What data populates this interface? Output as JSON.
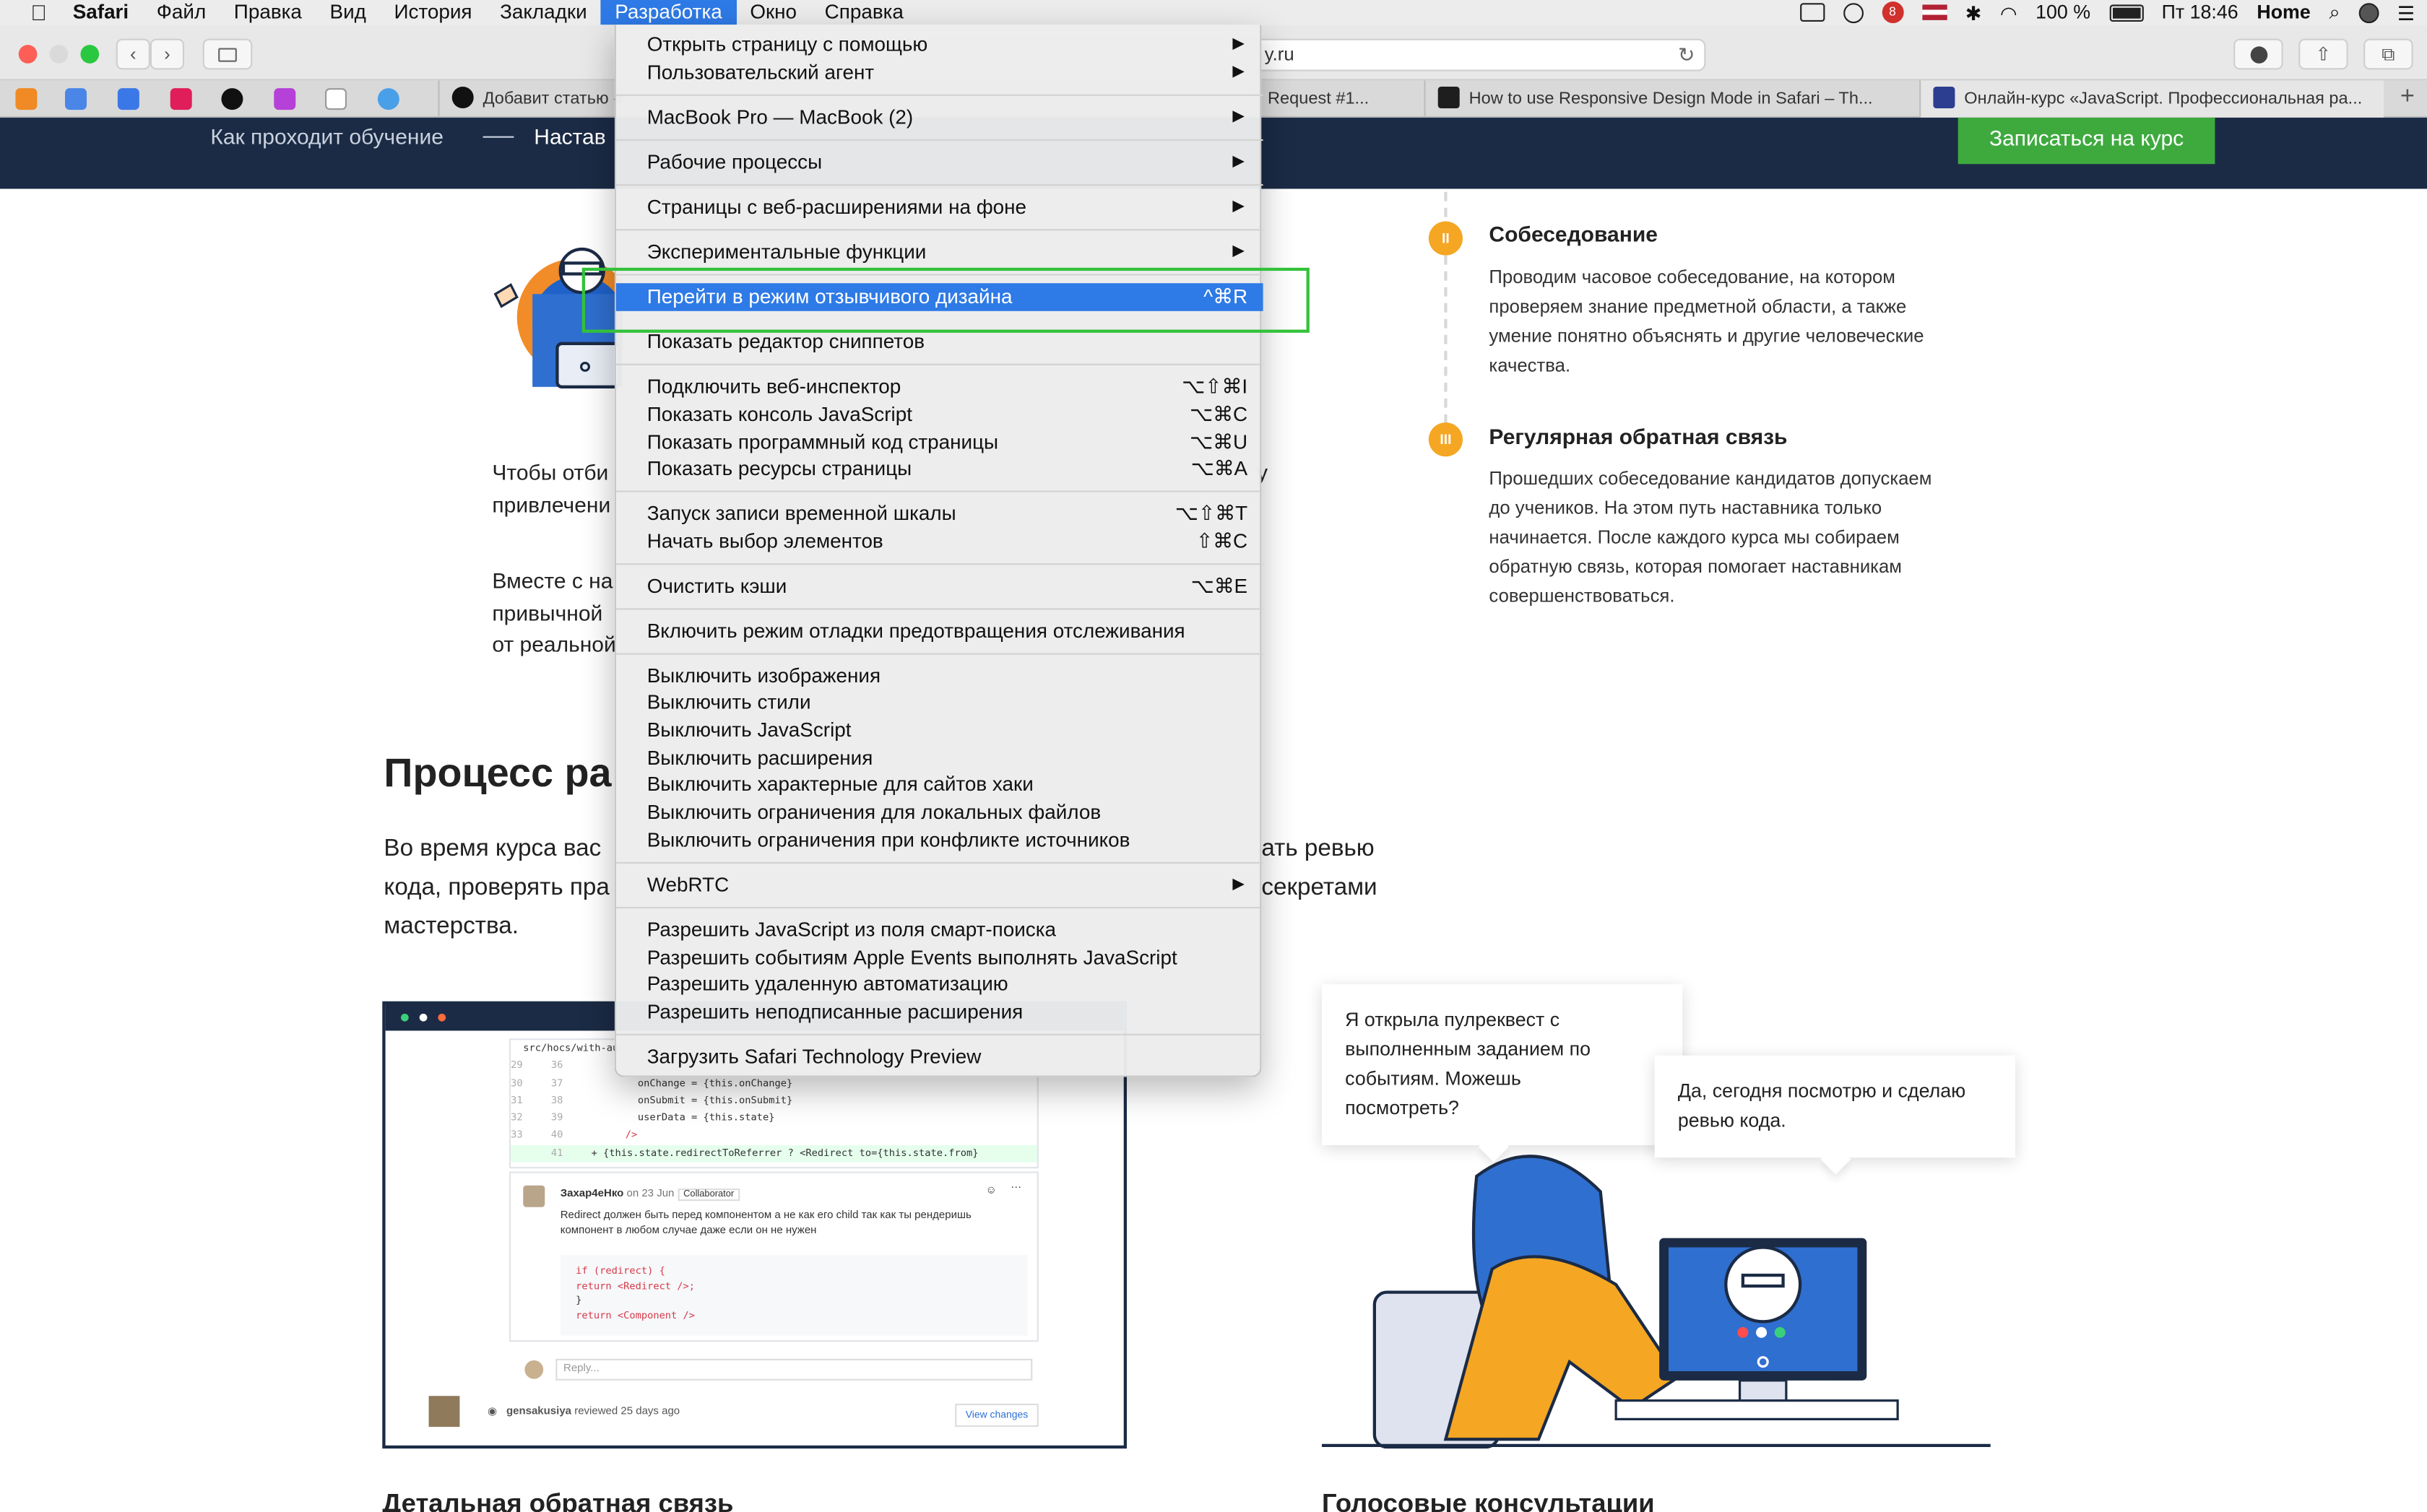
{
  "menubar": {
    "apple": "",
    "items": [
      "Safari",
      "Файл",
      "Правка",
      "Вид",
      "История",
      "Закладки",
      "Разработка",
      "Окно",
      "Справка"
    ],
    "active_index": 6,
    "battery": "100 %",
    "clock": "Пт 18:46",
    "user": "Home",
    "notification_count": "8"
  },
  "toolbar": {
    "address_text": "y.ru",
    "reload_glyph": "↻",
    "back_glyph": "‹",
    "forward_glyph": "›"
  },
  "tabs": [
    {
      "label": "Добавит статью «"
    },
    {
      "label": "Request #1..."
    },
    {
      "label": "How to use Responsive Design Mode in Safari – Th..."
    },
    {
      "label": "Онлайн-курс «JavaScript. Профессиональная ра..."
    }
  ],
  "page": {
    "nav_text_1": "Как проходит обучение",
    "nav_text_2": "Настав",
    "cta_label": "Записаться на курс",
    "steps": [
      {
        "badge": "II",
        "title": "Собеседование",
        "text": "Проводим часовое собеседование, на котором проверяем знание предметной области, а также умение понятно объяснять и другие человеческие качества."
      },
      {
        "badge": "III",
        "title": "Регулярная обратная связь",
        "text": "Прошедших собеседование кандидатов допускаем до учеников. На этом путь наставника только начинается. После каждого курса мы собираем обратную связь, которая помогает наставникам совершенствоваться."
      }
    ],
    "para1_l1": "Чтобы отби",
    "para1_l2": "привлечени",
    "para1_tail": "у",
    "para2_l1": "Вместе с на",
    "para2_l2": "привычной",
    "para2_l3": "от реальной",
    "section_title": "Процесс ра",
    "lead_l1a": "Во время курса вас",
    "lead_l1b": "ать ревью",
    "lead_l2a": "кода, проверять пра",
    "lead_l2b": "секретами",
    "lead_l3": "мастерства.",
    "bubble_1": "Я открыла пулреквест с выполненным заданием по событиям. Можешь посмотреть?",
    "bubble_2": "Да, сегодня посмотрю и сделаю ревью кода.",
    "bottom_head_left": "Детальная обратная связь",
    "bottom_head_right": "Голосовые консультации"
  },
  "code_card": {
    "path": "src/hocs/with-au",
    "lines": [
      {
        "a": "29",
        "b": "36",
        "code": ""
      },
      {
        "a": "30",
        "b": "37",
        "code": "onChange = {this.onChange}"
      },
      {
        "a": "31",
        "b": "38",
        "code": "onSubmit = {this.onSubmit}"
      },
      {
        "a": "32",
        "b": "39",
        "code": "userData = {this.state}"
      },
      {
        "a": "33",
        "b": "40",
        "code": "/>"
      },
      {
        "a": "",
        "b": "41",
        "code": "+      {this.state.redirectToReferrer ? <Redirect to={this.state.from}"
      }
    ],
    "author": "Захар4еНко",
    "date": "on 23 Jun",
    "role": "Collaborator",
    "comment": "Redirect должен быть перед компонентом а не как его child так как ты рендеришь компонент в любом случае даже если он не нужен",
    "snippet": [
      "if (redirect) {",
      "  return <Redirect />;",
      "}",
      "return <Component />"
    ],
    "reply_placeholder": "Reply...",
    "footer_user": "gensakusiya",
    "footer_text": "reviewed 25 days ago",
    "view_changes": "View changes"
  },
  "dev_menu": {
    "items": [
      {
        "label": "Открыть страницу с помощью",
        "shortcut": "",
        "submenu": true
      },
      {
        "label": "Пользовательский агент",
        "shortcut": "",
        "submenu": true
      },
      {
        "label": "MacBook Pro — MacBook (2)",
        "shortcut": "",
        "submenu": true
      },
      {
        "label": "Рабочие процессы",
        "shortcut": "",
        "submenu": true
      },
      {
        "label": "Страницы с веб-расширениями на фоне",
        "shortcut": "",
        "submenu": true
      },
      {
        "label": "Экспериментальные функции",
        "shortcut": "",
        "submenu": true
      },
      {
        "label": "Перейти в режим отзывчивого дизайна",
        "shortcut": "^⌘R",
        "submenu": false
      },
      {
        "label": "Показать редактор сниппетов",
        "shortcut": "",
        "submenu": false
      },
      {
        "label": "Подключить веб-инспектор",
        "shortcut": "⌥⇧⌘I",
        "submenu": false
      },
      {
        "label": "Показать консоль JavaScript",
        "shortcut": "⌥⌘C",
        "submenu": false
      },
      {
        "label": "Показать программный код страницы",
        "shortcut": "⌥⌘U",
        "submenu": false
      },
      {
        "label": "Показать ресурсы страницы",
        "shortcut": "⌥⌘A",
        "submenu": false
      },
      {
        "label": "Запуск записи временной шкалы",
        "shortcut": "⌥⇧⌘T",
        "submenu": false
      },
      {
        "label": "Начать выбор элементов",
        "shortcut": "⇧⌘C",
        "submenu": false
      },
      {
        "label": "Очистить кэши",
        "shortcut": "⌥⌘E",
        "submenu": false
      },
      {
        "label": "Включить режим отладки предотвращения отслеживания",
        "shortcut": "",
        "submenu": false
      },
      {
        "label": "Выключить изображения",
        "shortcut": "",
        "submenu": false
      },
      {
        "label": "Выключить стили",
        "shortcut": "",
        "submenu": false
      },
      {
        "label": "Выключить JavaScript",
        "shortcut": "",
        "submenu": false
      },
      {
        "label": "Выключить расширения",
        "shortcut": "",
        "submenu": false
      },
      {
        "label": "Выключить характерные для сайтов хаки",
        "shortcut": "",
        "submenu": false
      },
      {
        "label": "Выключить ограничения для локальных файлов",
        "shortcut": "",
        "submenu": false
      },
      {
        "label": "Выключить ограничения при конфликте источников",
        "shortcut": "",
        "submenu": false
      },
      {
        "label": "WebRTC",
        "shortcut": "",
        "submenu": true
      },
      {
        "label": "Разрешить JavaScript из поля смарт-поиска",
        "shortcut": "",
        "submenu": false
      },
      {
        "label": "Разрешить событиям Apple Events выполнять JavaScript",
        "shortcut": "",
        "submenu": false
      },
      {
        "label": "Разрешить удаленную автоматизацию",
        "shortcut": "",
        "submenu": false
      },
      {
        "label": "Разрешить неподписанные расширения",
        "shortcut": "",
        "submenu": false
      },
      {
        "label": "Загрузить Safari Technology Preview",
        "shortcut": "",
        "submenu": false
      }
    ],
    "selected_index": 6,
    "arrow_glyph": "▶"
  },
  "colors": {
    "accent": "#2e7ae6",
    "highlight_box": "#33c13a",
    "nav_bg": "#1b2b45",
    "cta": "#3eaa3e",
    "badge": "#f5a623"
  }
}
